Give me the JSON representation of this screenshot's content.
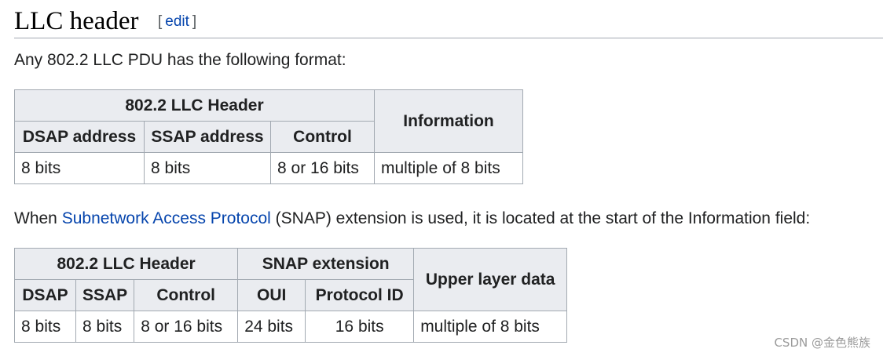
{
  "section": {
    "title": "LLC header",
    "edit_open": "[",
    "edit_label": "edit",
    "edit_close": "]"
  },
  "intro1": "Any 802.2 LLC PDU has the following format:",
  "table1": {
    "group_header": "802.2 LLC Header",
    "info_header": "Information",
    "columns": [
      "DSAP address",
      "SSAP address",
      "Control"
    ],
    "row": [
      "8 bits",
      "8 bits",
      "8 or 16 bits",
      "multiple of 8 bits"
    ]
  },
  "intro2": {
    "before": "When ",
    "link": "Subnetwork Access Protocol",
    "after": " (SNAP) extension is used, it is located at the start of the Information field:"
  },
  "table2": {
    "group_header_llc": "802.2 LLC Header",
    "group_header_snap": "SNAP extension",
    "upper_header": "Upper layer data",
    "columns": [
      "DSAP",
      "SSAP",
      "Control",
      "OUI",
      "Protocol ID"
    ],
    "row": [
      "8 bits",
      "8 bits",
      "8 or 16 bits",
      "24 bits",
      "16 bits",
      "multiple of 8 bits"
    ]
  },
  "watermark": "CSDN @金色熊族"
}
